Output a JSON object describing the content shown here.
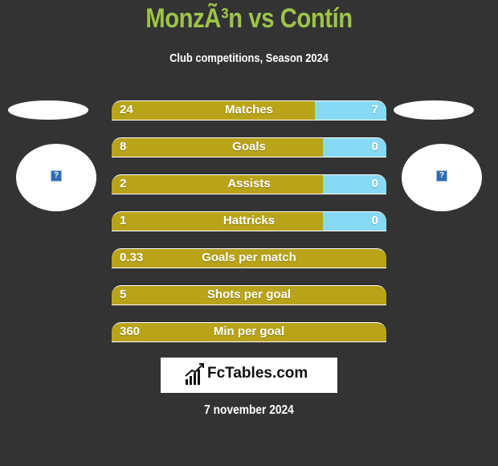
{
  "header": {
    "title": "MonzÃ³n vs Contín",
    "subtitle": "Club competitions, Season 2024"
  },
  "players": {
    "left": {
      "image_icon": "broken-image-icon",
      "image_glyph": "?"
    },
    "right": {
      "image_icon": "broken-image-icon",
      "image_glyph": "?"
    }
  },
  "colors": {
    "title": "#9dc34a",
    "left_bar": "#b9a319",
    "right_bar": "#87d9f5",
    "background": "#333333"
  },
  "stats": [
    {
      "label": "Matches",
      "left": "24",
      "right": "7",
      "left_share": 0.74
    },
    {
      "label": "Goals",
      "left": "8",
      "right": "0",
      "left_share": 0.77
    },
    {
      "label": "Assists",
      "left": "2",
      "right": "0",
      "left_share": 0.77
    },
    {
      "label": "Hattricks",
      "left": "1",
      "right": "0",
      "left_share": 0.77
    },
    {
      "label": "Goals per match",
      "left": "0.33",
      "right": "",
      "left_share": 1.0
    },
    {
      "label": "Shots per goal",
      "left": "5",
      "right": "",
      "left_share": 1.0
    },
    {
      "label": "Min per goal",
      "left": "360",
      "right": "",
      "left_share": 1.0
    }
  ],
  "footer": {
    "logo_text": "FcTables.com",
    "logo_icon": "bar-chart-icon",
    "date": "7 november 2024"
  }
}
